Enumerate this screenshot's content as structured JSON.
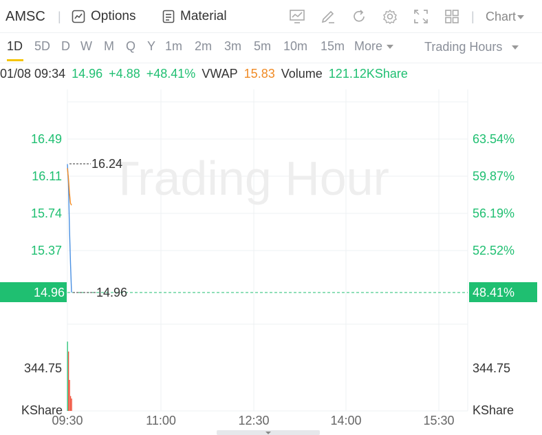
{
  "header": {
    "symbol": "AMSC",
    "separator": "|",
    "options_label": "Options",
    "material_label": "Material",
    "chart_label": "Chart"
  },
  "periods": [
    "1D",
    "5D",
    "D",
    "W",
    "M",
    "Q",
    "Y",
    "1m",
    "2m",
    "3m",
    "5m",
    "10m",
    "15m"
  ],
  "period_active": "1D",
  "more_label": "More",
  "session_label": "Trading Hours",
  "info": {
    "datetime": "01/08 09:34",
    "price": "14.96",
    "change": "+4.88",
    "change_pct": "+48.41%",
    "vwap_label": "VWAP",
    "vwap_value": "15.83",
    "volume_label": "Volume",
    "volume_value": "121.12KShare"
  },
  "chart": {
    "watermark": "Trading Hour",
    "price_axis_labels": [
      "16.49",
      "16.11",
      "15.74",
      "15.37"
    ],
    "pct_axis_labels": [
      "63.54%",
      "59.87%",
      "56.19%",
      "52.52%"
    ],
    "current_price_tag": "14.96",
    "current_pct_tag": "48.41%",
    "high_marker": "16.24",
    "last_marker": "14.96",
    "volume_axis_left": "344.75",
    "volume_axis_right": "344.75",
    "volume_unit_left": "KShare",
    "volume_unit_right": "KShare",
    "time_labels": [
      "09:30",
      "11:00",
      "12:30",
      "14:00",
      "15:30"
    ],
    "colors": {
      "up": "#1fbf71",
      "down": "#f0553f",
      "price_line": "#4a90e2",
      "avg_line": "#f08a24"
    }
  },
  "chart_data": {
    "type": "line",
    "x": [
      "09:30",
      "09:31",
      "09:32",
      "09:33",
      "09:34"
    ],
    "series": [
      {
        "values": [
          16.24,
          16.05,
          15.6,
          15.25,
          14.96
        ]
      },
      {
        "values": [
          16.2,
          16.1,
          15.95,
          15.85,
          15.83
        ]
      }
    ],
    "volume": {
      "x": [
        "09:30",
        "09:31",
        "09:32",
        "09:33",
        "09:34"
      ],
      "values": [
        560,
        480,
        250,
        120,
        100
      ],
      "colors": [
        "up",
        "down",
        "down",
        "down",
        "down"
      ]
    },
    "ylim": [
      14.96,
      16.6
    ],
    "xrange": [
      "09:30",
      "16:00"
    ]
  }
}
